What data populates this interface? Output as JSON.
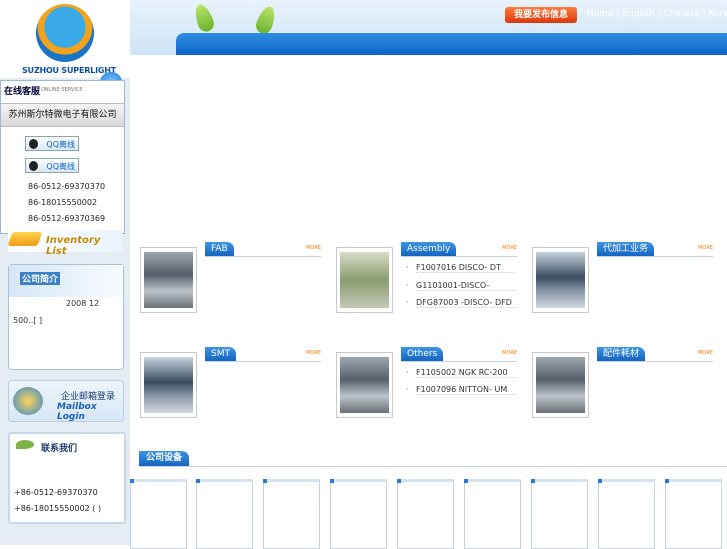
{
  "header": {
    "publish_label": "我要发布信息",
    "links": [
      "Home",
      "English",
      "Chinese",
      "Korea"
    ],
    "separator": "|"
  },
  "brand": {
    "logo_text": "SUZHOU SUPERLIGHT"
  },
  "online_service": {
    "title": "在线客服",
    "subtitle": "ONLINE SERVICE",
    "company": "苏州斯尔特微电子有限公司",
    "qq_buttons": [
      "QQ离线",
      "QQ离线"
    ],
    "phones": [
      "86-0512-69370370",
      "86-18015550002",
      "86-0512-69370369"
    ]
  },
  "inventory": {
    "label": "Inventory List"
  },
  "intro": {
    "title": "公司简介",
    "date": "2008 12",
    "more": "500..[ ]"
  },
  "mailbox": {
    "cn": "企业邮箱登录",
    "en": "Mailbox Login"
  },
  "contact": {
    "title": "联系我们",
    "phones": [
      "+86-0512-69370370",
      "+86-18015550002 ( )"
    ]
  },
  "modules": [
    {
      "title": "FAB",
      "more": "MORE",
      "items": []
    },
    {
      "title": "Assembly",
      "more": "MORE",
      "items": [
        "F1007016 DISCO- DT",
        "G1101001-DISCO-",
        "DFG87003 -DISCO- DFD"
      ]
    },
    {
      "title": "代加工业务",
      "more": "MORE",
      "items": []
    },
    {
      "title": "SMT",
      "more": "MORE",
      "items": []
    },
    {
      "title": "Others",
      "more": "MORE",
      "items": [
        "F1105002 NGK RC-200",
        "F1007096 NITTON- UM"
      ]
    },
    {
      "title": "配件耗材",
      "more": "MORE",
      "items": []
    }
  ],
  "equipment": {
    "title": "公司设备"
  },
  "colors": {
    "accent_blue": "#1564c0",
    "publish_orange": "#d8380f",
    "inventory_gold": "#c58a00"
  }
}
